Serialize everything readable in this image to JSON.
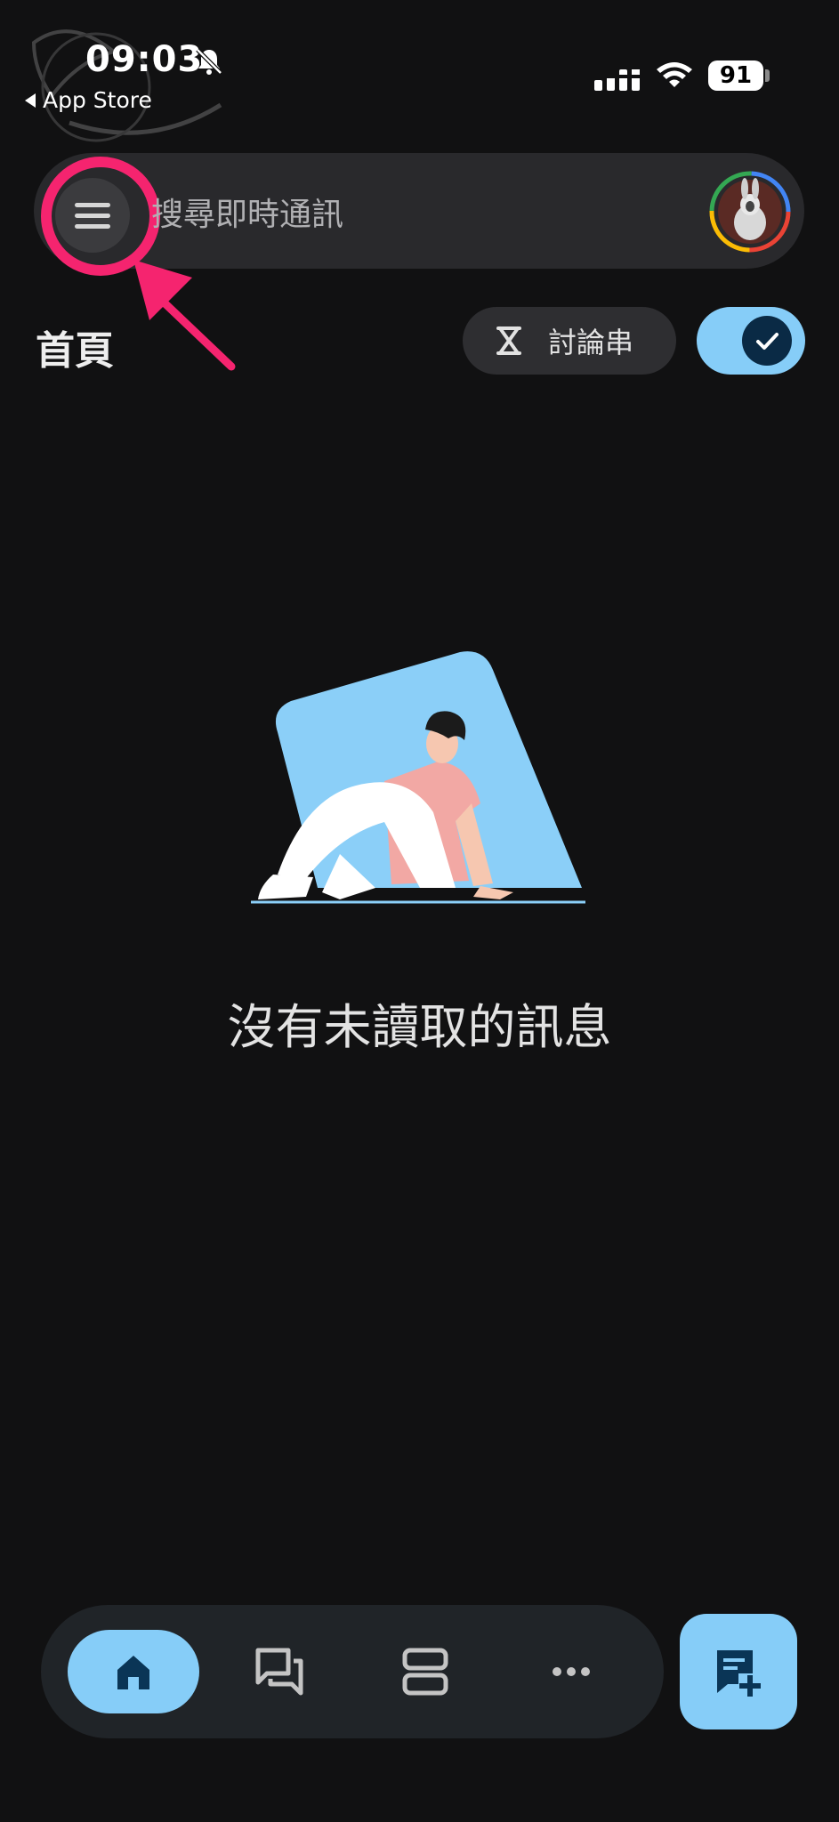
{
  "status_bar": {
    "time": "09:03",
    "back_label": "App Store",
    "battery": "91",
    "icons": [
      "bell-slash-icon",
      "cellular-signal-icon",
      "wifi-icon",
      "battery-icon"
    ]
  },
  "search": {
    "placeholder": "搜尋即時通訊",
    "menu_icon": "hamburger-menu-icon"
  },
  "header": {
    "title": "首頁",
    "threads_label": "討論串",
    "threads_icon": "threads-icon"
  },
  "empty_state": {
    "message": "沒有未讀取的訊息"
  },
  "bottom_nav": {
    "items": [
      {
        "icon": "home-icon",
        "selected": true
      },
      {
        "icon": "chat-icon",
        "selected": false
      },
      {
        "icon": "spaces-icon",
        "selected": false
      },
      {
        "icon": "more-icon",
        "selected": false
      }
    ],
    "fab_icon": "new-chat-icon"
  },
  "colors": {
    "background": "#111112",
    "accent": "#86cdf8",
    "annotation": "#f5246f",
    "surface": "#29292c"
  }
}
